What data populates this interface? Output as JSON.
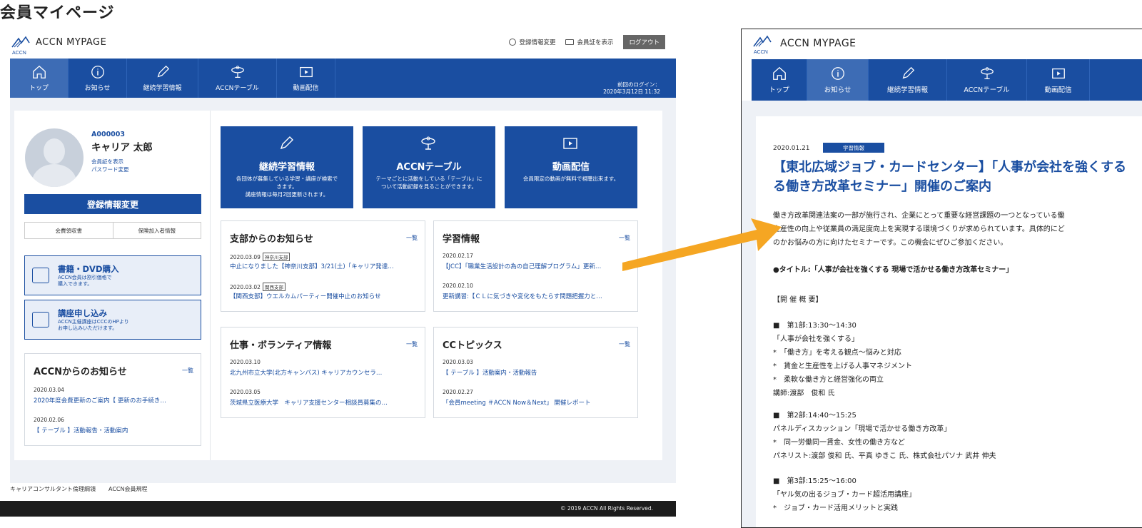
{
  "page_heading": "会員マイページ",
  "site": {
    "logo_small": "ACCN",
    "name": "ACCN MYPAGE"
  },
  "header_links": {
    "edit_registration": "登録情報変更",
    "show_card": "会員証を表示",
    "logout": "ログアウト"
  },
  "nav": [
    {
      "label": "トップ",
      "icon": "home-icon"
    },
    {
      "label": "お知らせ",
      "icon": "info-icon"
    },
    {
      "label": "継続学習情報",
      "icon": "pencil-icon"
    },
    {
      "label": "ACCNテーブル",
      "icon": "table-icon"
    },
    {
      "label": "動画配信",
      "icon": "video-icon"
    }
  ],
  "last_login": {
    "label": "前回のログイン：",
    "value": "2020年3月12日 11:32"
  },
  "profile": {
    "id": "A000003",
    "name": "キャリア 太郎",
    "link1": "会員証を表示",
    "link2": "パスワード変更"
  },
  "edit_button": "登録情報変更",
  "twin_links": [
    "会費領収書",
    "保険加入者情報"
  ],
  "promos": [
    {
      "title": "書籍・DVD購入",
      "desc1": "ACCN会員は割引価格で",
      "desc2": "購入できます。"
    },
    {
      "title": "講座申し込み",
      "desc1": "ACCN主催講座はCCCのHPより",
      "desc2": "お申し込みいただけます。"
    }
  ],
  "features": [
    {
      "title": "継続学習情報",
      "d1": "各団体が募集している学習・講座が検索で",
      "d2": "きます。",
      "d3": "講座情報は毎月2回更新されます。"
    },
    {
      "title": "ACCNテーブル",
      "d1": "テーマごとに活動をしている「テーブル」に",
      "d2": "ついて活動記録を見ることができます。",
      "d3": ""
    },
    {
      "title": "動画配信",
      "d1": "会員限定の動画が無料で視聴出来ます。",
      "d2": "",
      "d3": ""
    }
  ],
  "more": "一覧",
  "notices": {
    "accn": {
      "title": "ACCNからのお知らせ",
      "items": [
        {
          "date": "2020.03.04",
          "text": "2020年度会費更新のご案内【 更新のお手続き…"
        },
        {
          "date": "2020.02.06",
          "text": "【 テーブル 】活動報告・活動案内"
        }
      ]
    },
    "branch": {
      "title": "支部からのお知らせ",
      "items": [
        {
          "date": "2020.03.09",
          "tag": "神奈川支部",
          "text": "中止になりました【神奈川支部】3/21(土)「キャリア発達…"
        },
        {
          "date": "2020.03.02",
          "tag": "関西支部",
          "text": "【関西支部】ウエルカムパーティー開催中止のお知らせ"
        }
      ]
    },
    "study": {
      "title": "学習情報",
      "items": [
        {
          "date": "2020.02.17",
          "text": "【JCC】「職業生活設計の為の自己理解プログラム」更新…"
        },
        {
          "date": "2020.02.10",
          "text": "更新講習:【ＣＬに気づきや変化をもたらす問題把握力と…"
        }
      ]
    },
    "work": {
      "title": "仕事・ボランティア情報",
      "items": [
        {
          "date": "2020.03.10",
          "text": "北九州市立大学(北方キャンパス) キャリアカウンセラ…"
        },
        {
          "date": "2020.03.05",
          "text": "茨城県立医療大学　キャリア支援センター相談員募集の…"
        }
      ]
    },
    "cc": {
      "title": "CCトピックス",
      "items": [
        {
          "date": "2020.03.03",
          "text": "【 テーブル 】活動案内・活動報告"
        },
        {
          "date": "2020.02.27",
          "text": "「会員meeting ＃ACCN Now＆Next」 開催レポート"
        }
      ]
    }
  },
  "footer": {
    "link1": "キャリアコンサルタント倫理綱領",
    "link2": "ACCN会員規程",
    "copyright": "© 2019 ACCN All Rights Reserved."
  },
  "detail": {
    "date": "2020.01.21",
    "tag": "学習情報",
    "title": "【東北広域ジョブ・カードセンター】「人事が会社を強くする\nる働き方改革セミナー」開催のご案内",
    "intro": "働き方改革関連法案の一部が施行され、企業にとって重要な経営課題の一つとなっている働\n生産性の向上や従業員の満足度向上を実現する環境づくりが求められています。具体的にど\nのかお悩みの方に向けたセミナーです。この機会にぜひご参加ください。",
    "subject": "●タイトル:「人事が会社を強くする 現場で活かせる働き方改革セミナー」",
    "overview": "【開 催 概 要】",
    "part1": "■　第1部:13:30〜14:30\n「人事が会社を強くする」\n*　「働き方」を考える観点〜悩みと対応\n*　賃金と生産性を上げる人事マネジメント\n*　柔軟な働き方と経営強化の両立\n講師:渡部　俊和 氏",
    "part2": "■　第2部:14:40〜15:25\nパネルディスカッション「現場で活かせる働き方改革」\n*　同一労働同一賃金、女性の働き方など\nパネリスト:渡部 俊和 氏、平真 ゆきこ 氏、株式会社パソナ 武井 伸夫",
    "part3": "■　第3部:15:25〜16:00\n「ヤル気の出るジョブ・カード超活用講座」\n*　ジョブ・カード活用メリットと実践"
  },
  "colors": {
    "brand": "#1a4ea1",
    "arrow": "#f5a623"
  }
}
